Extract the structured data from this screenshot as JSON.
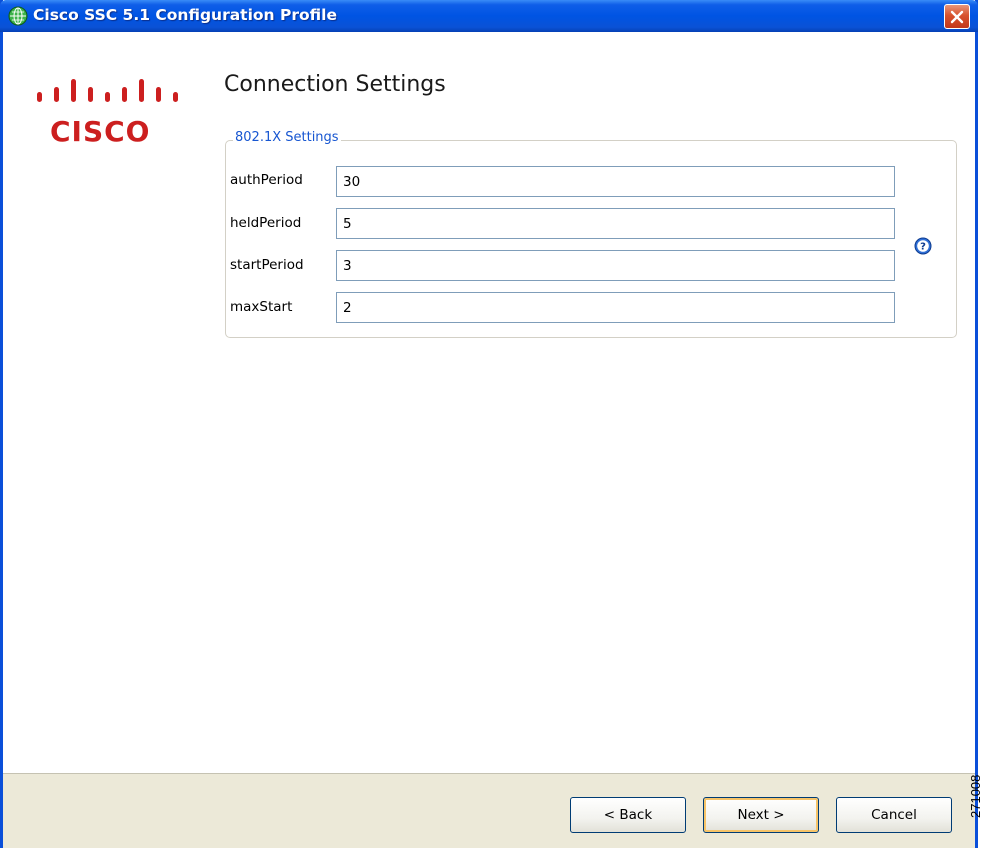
{
  "window": {
    "title": "Cisco SSC 5.1 Configuration Profile",
    "icon": "cisco-ssc-globe-icon",
    "close_icon": "close-icon",
    "accent_color": "#0054e3",
    "close_color": "#d8522d"
  },
  "logo": {
    "word": "CISCO",
    "bars_icon": "cisco-bridge-bars",
    "color": "#cc1f1f"
  },
  "page": {
    "title": "Connection Settings"
  },
  "group": {
    "legend": "802.1X Settings",
    "legend_color": "#1756d1",
    "help_icon": "help-question-icon",
    "fields": [
      {
        "label": "authPeriod",
        "value": "30"
      },
      {
        "label": "heldPeriod",
        "value": "5"
      },
      {
        "label": "startPeriod",
        "value": "3"
      },
      {
        "label": "maxStart",
        "value": "2"
      }
    ]
  },
  "buttons": {
    "back": "< Back",
    "next": "Next >",
    "cancel": "Cancel"
  },
  "figure_id": "271008"
}
